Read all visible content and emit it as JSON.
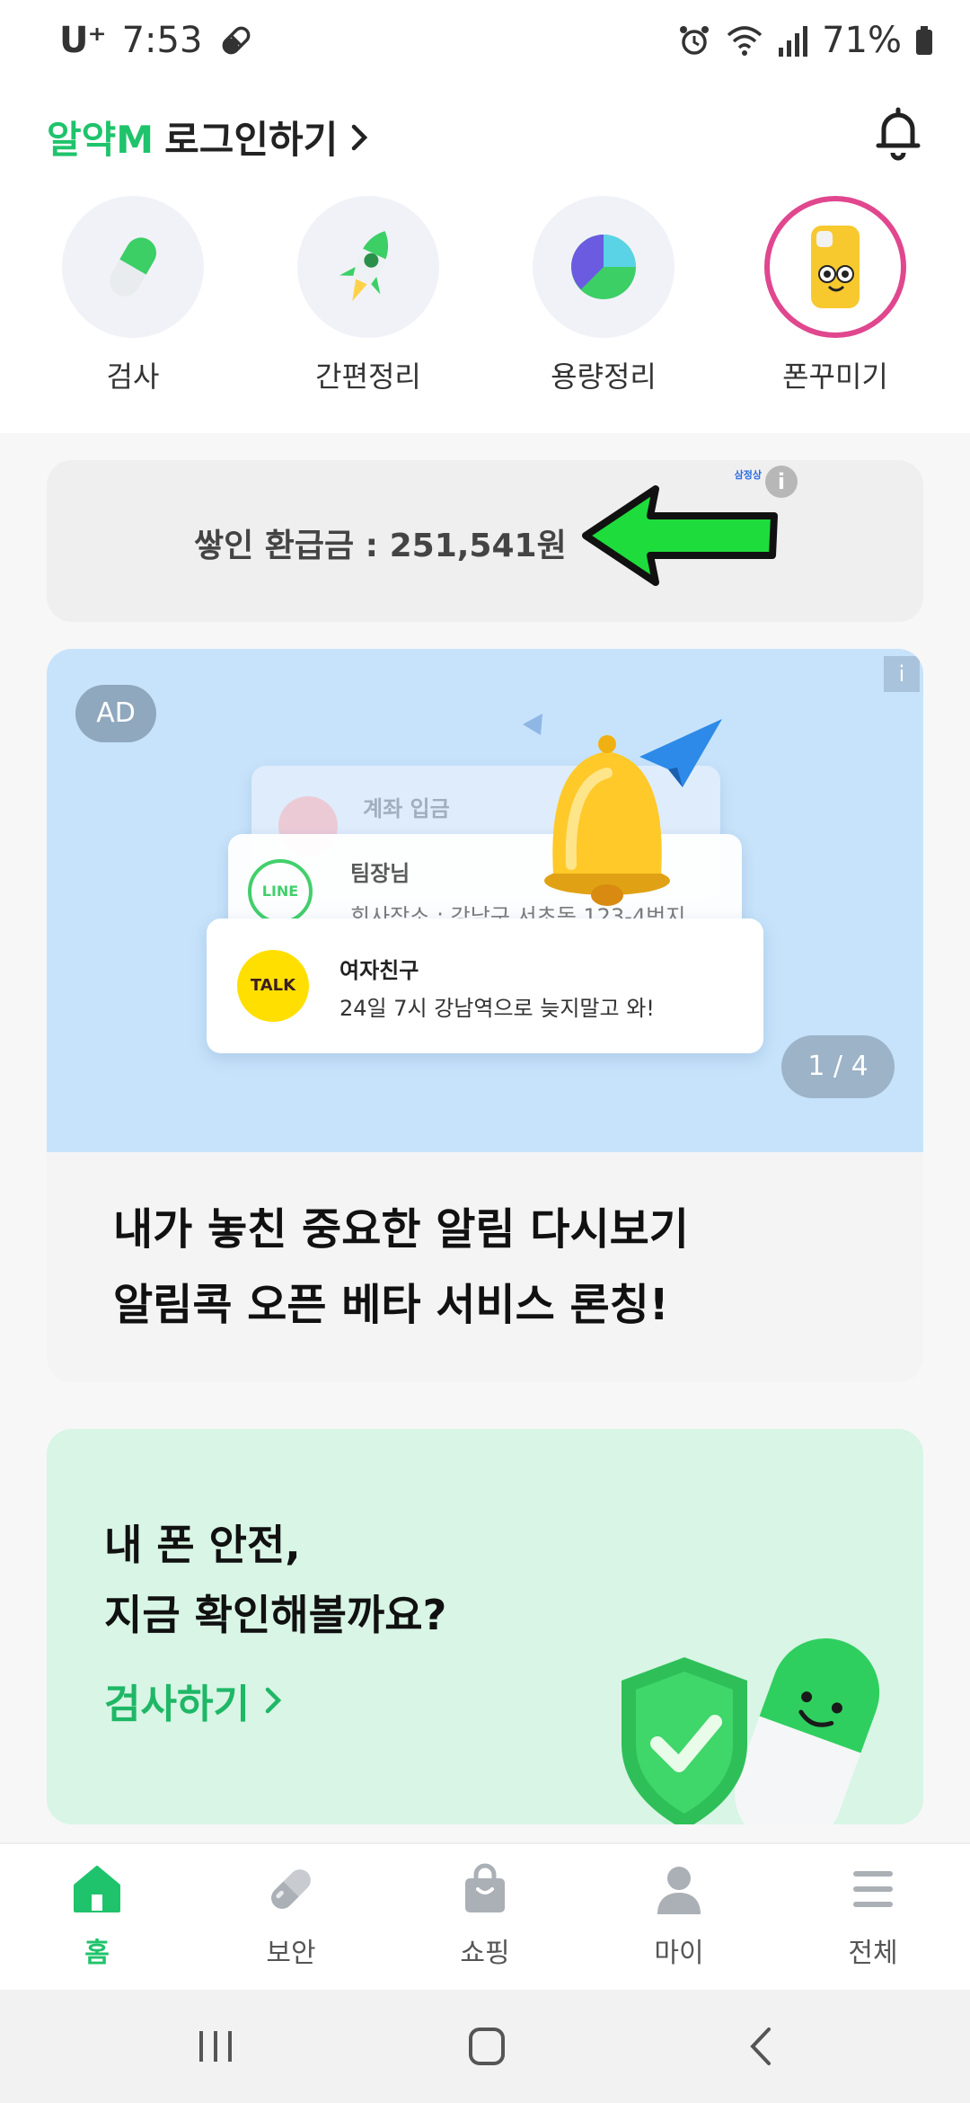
{
  "status_bar": {
    "carrier": "U⁺",
    "time": "7:53",
    "battery": "71%"
  },
  "header": {
    "brand": "알약M",
    "login_label": "로그인하기",
    "chevron": "›"
  },
  "quick_menu": [
    {
      "label": "검사",
      "icon": "pill-icon"
    },
    {
      "label": "간편정리",
      "icon": "rocket-icon"
    },
    {
      "label": "용량정리",
      "icon": "pie-chart-icon"
    },
    {
      "label": "폰꾸미기",
      "icon": "phone-case-icon"
    }
  ],
  "refund_card": {
    "text": "쌓인 환급금 : 251,541원",
    "tag": "삼정상",
    "info": "i"
  },
  "ad_banner": {
    "badge": "AD",
    "info": "i",
    "notif_back_title": "계좌 입금",
    "notif_mid_title": "팀장님",
    "notif_mid_body": "회사장소 : 강남구 서초동 123-4번지",
    "notif_mid_icon_text": "LINE",
    "notif_front_title": "여자친구",
    "notif_front_body": "24일 7시 강남역으로 늦지말고 와!",
    "notif_front_icon_text": "TALK",
    "pager": "1 / 4",
    "headline_line1": "내가 놓친 중요한 알림 다시보기",
    "headline_line2": "알림콕 오픈 베타 서비스 론칭!"
  },
  "safety_card": {
    "title_line1": "내 폰 안전,",
    "title_line2": "지금 확인해볼까요?",
    "link_label": "검사하기",
    "chevron": "›"
  },
  "bottom_nav": [
    {
      "label": "홈",
      "icon": "home-icon",
      "active": true
    },
    {
      "label": "보안",
      "icon": "shield-pill-icon",
      "active": false
    },
    {
      "label": "쇼핑",
      "icon": "shopping-bag-icon",
      "active": false
    },
    {
      "label": "마이",
      "icon": "person-icon",
      "active": false
    },
    {
      "label": "전체",
      "icon": "menu-icon",
      "active": false
    }
  ],
  "colors": {
    "brand_green": "#1fc36b",
    "ad_blue": "#c7e3fb",
    "safety_mint": "#d8f5e5"
  }
}
